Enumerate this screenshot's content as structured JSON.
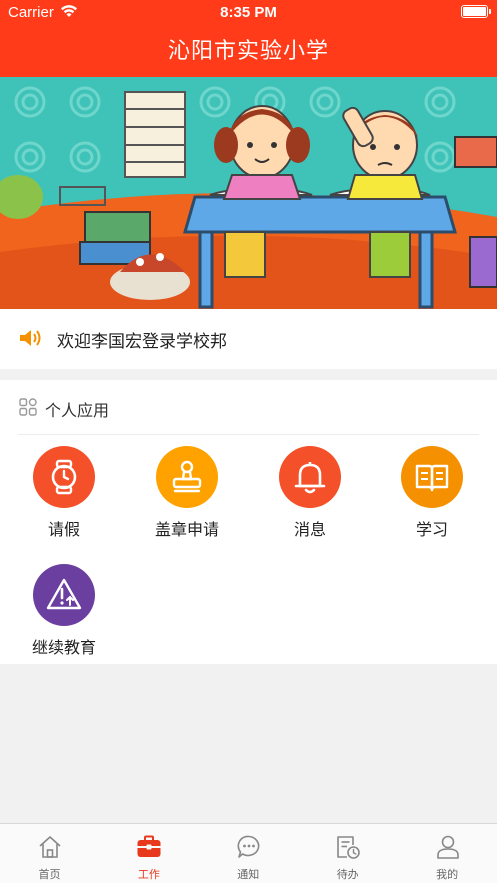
{
  "status_bar": {
    "carrier": "Carrier",
    "time": "8:35 PM"
  },
  "header": {
    "title": "沁阳市实验小学"
  },
  "welcome": {
    "text": "欢迎李国宏登录学校邦"
  },
  "apps": {
    "section_title": "个人应用",
    "items": [
      {
        "label": "请假",
        "icon": "watch-icon",
        "color": "#f4502a"
      },
      {
        "label": "盖章申请",
        "icon": "stamp-icon",
        "color": "#ffa200"
      },
      {
        "label": "消息",
        "icon": "bell-icon",
        "color": "#f4502a"
      },
      {
        "label": "学习",
        "icon": "book-icon",
        "color": "#f59100"
      },
      {
        "label": "继续教育",
        "icon": "warning-upload-icon",
        "color": "#6a3fa0"
      }
    ]
  },
  "tabs": [
    {
      "label": "首页",
      "icon": "home-icon"
    },
    {
      "label": "工作",
      "icon": "briefcase-icon",
      "active": true
    },
    {
      "label": "通知",
      "icon": "chat-icon"
    },
    {
      "label": "待办",
      "icon": "todo-icon"
    },
    {
      "label": "我的",
      "icon": "user-icon"
    }
  ],
  "colors": {
    "header_bg": "#ff3b1a",
    "accent": "#e8391d"
  }
}
